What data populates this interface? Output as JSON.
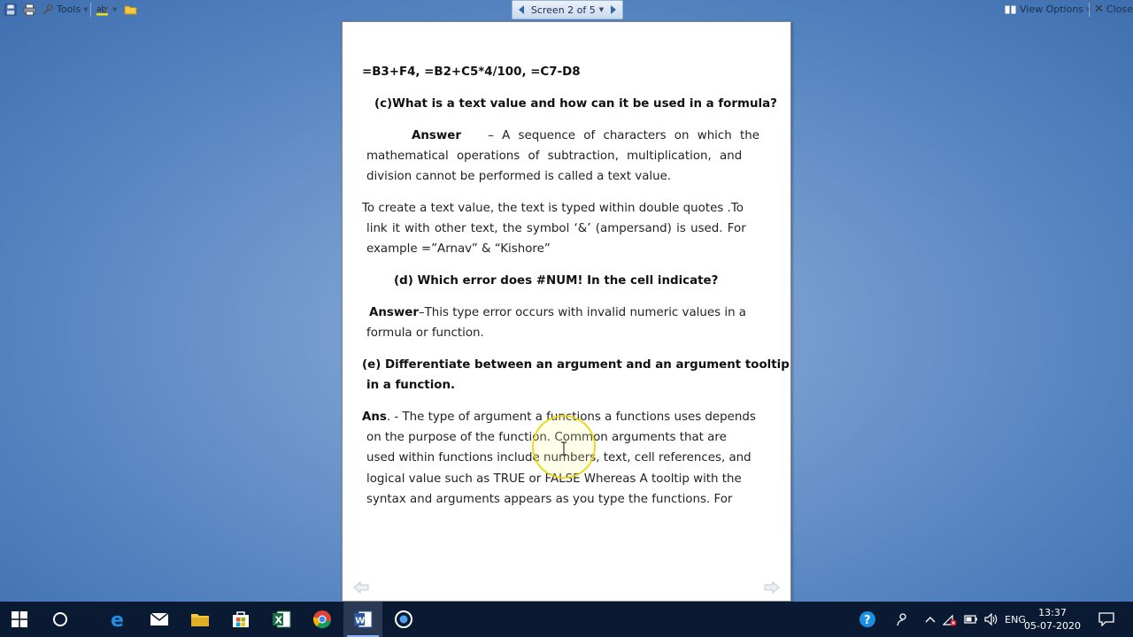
{
  "toolbar": {
    "tools_label": "Tools",
    "screen_label": "Screen 2 of 5",
    "view_options_label": "View Options",
    "close_label": "Close"
  },
  "document": {
    "formula_line": "=B3+F4, =B2+C5*4/100, =C7-D8",
    "q_c": "(c)What is a text value and how can it be used in a formula?",
    "ans_c_label": "Answer",
    "ans_c_l1_rest": "– A sequence of characters on which the",
    "ans_c_l2": "mathematical operations of subtraction, multiplication, and",
    "ans_c_l3": "division cannot be performed is called a text value.",
    "para_text_l1": "To create a text value, the text is typed within double quotes .To",
    "para_text_l2": "link it with other text, the symbol ‘&’ (ampersand) is used. For",
    "para_text_l3": "example =”Arnav” & “Kishore”",
    "q_d": "(d) Which error does #NUM! In the cell indicate?",
    "ans_d_label": "Answer",
    "ans_d_l1_rest": "–This type error occurs with invalid numeric values in a",
    "ans_d_l2": "formula or function.",
    "q_e_l1": "(e) Differentiate between an argument and an argument tooltip",
    "q_e_l2": "in a function.",
    "ans_e_label": "Ans",
    "ans_e_l1_rest": ". - The type of argument a functions a functions uses depends",
    "ans_e_l2": "on the purpose of the function. Common arguments that are",
    "ans_e_l3": "used within functions include numbers, text, cell references, and",
    "ans_e_l4": "logical value such as TRUE or FALSE Whereas A tooltip with the",
    "ans_e_l5": "syntax and arguments appears as you type the functions. For"
  },
  "taskbar": {
    "language": "ENG",
    "time": "13:37",
    "date": "05-07-2020"
  },
  "colors": {
    "taskbar_bg": "#0a1a33",
    "desktop_blue": "#7199cc",
    "highlight_yellow": "#ebd200"
  }
}
